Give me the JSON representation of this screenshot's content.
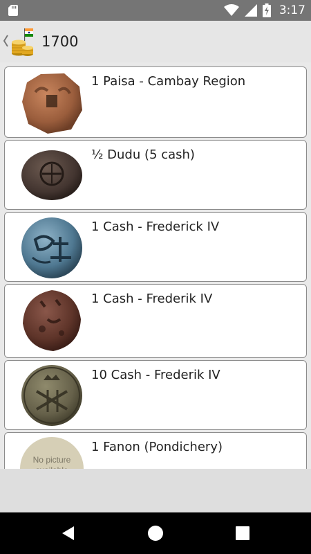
{
  "status_bar": {
    "time": "3:17",
    "icons": [
      "sd-card-icon",
      "wifi-icon",
      "signal-icon",
      "battery-icon"
    ]
  },
  "app_bar": {
    "title": "1700",
    "back_icon": "chevron-left-icon",
    "app_icon": "coins-with-flag-icon"
  },
  "coins": [
    {
      "name": "1 Paisa - Cambay Region"
    },
    {
      "name": "½ Dudu (5 cash)"
    },
    {
      "name": "1 Cash - Frederick IV"
    },
    {
      "name": "1 Cash - Frederik IV"
    },
    {
      "name": "10 Cash - Frederik IV"
    },
    {
      "name": "1 Fanon (Pondichery)",
      "placeholder": "No picture available"
    }
  ],
  "nav_bar": {
    "icons": [
      "back-triangle-icon",
      "home-circle-icon",
      "recents-square-icon"
    ]
  },
  "colors": {
    "status_bar": "#757575",
    "app_bar": "#e6e6e6",
    "card_border": "#8c8c8c",
    "nav_bar": "#000000"
  }
}
